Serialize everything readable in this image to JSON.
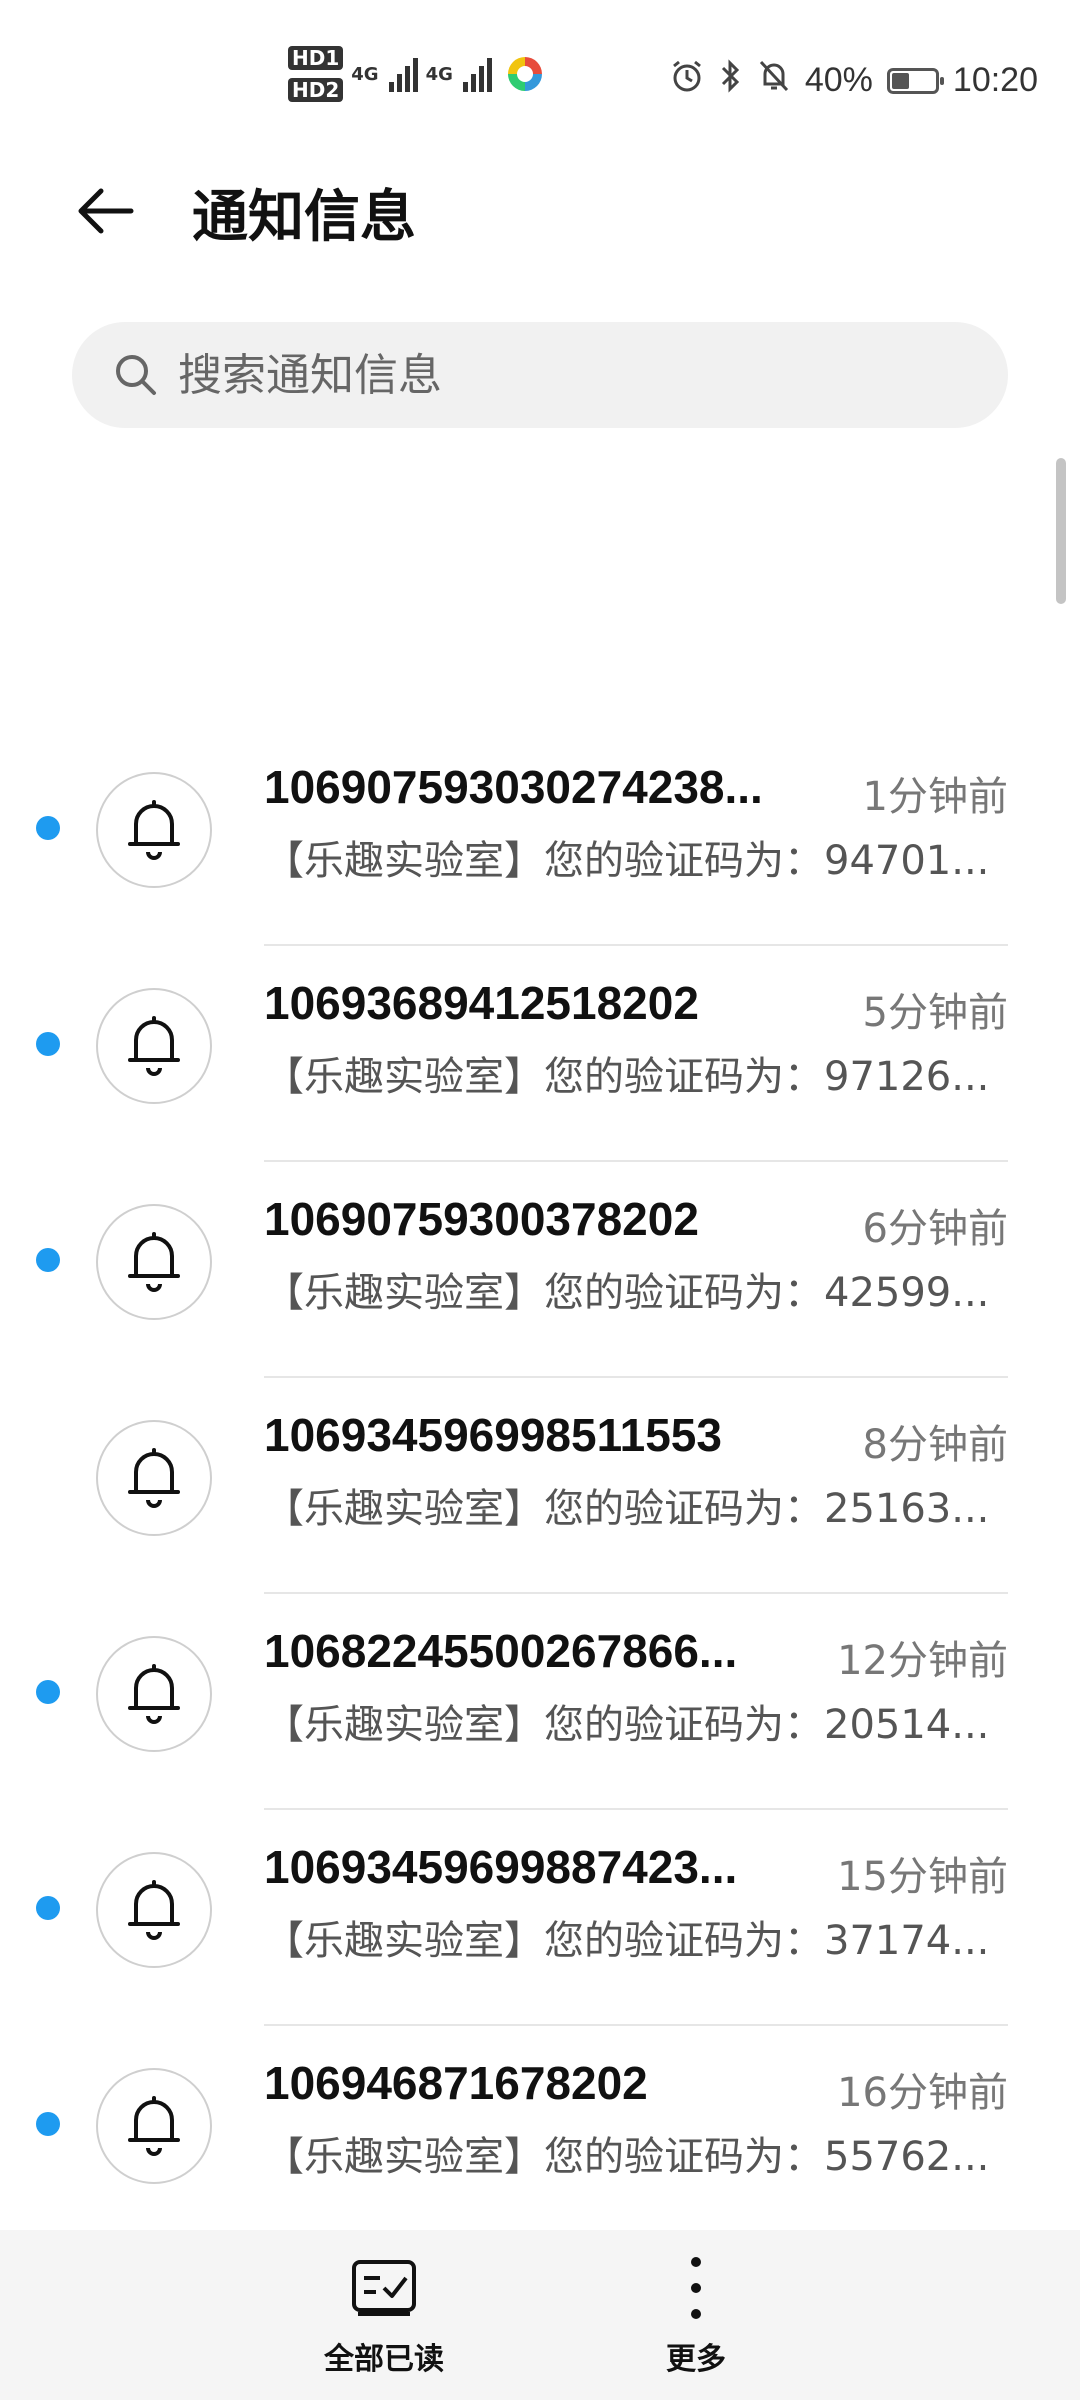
{
  "status_bar": {
    "hd1": "HD1",
    "hd2": "HD2",
    "net1": "4G",
    "net2": "4G",
    "battery_percent": "40%",
    "battery_level": 0.4,
    "time": "10:20",
    "icons": [
      "alarm-icon",
      "bluetooth-icon",
      "mute-bell-icon",
      "battery-icon"
    ]
  },
  "header": {
    "title": "通知信息"
  },
  "search": {
    "placeholder": "搜索通知信息"
  },
  "messages": [
    {
      "sender": "10690759303027423​8...",
      "time": "1分钟前",
      "preview": "【乐趣实验室】您的验证码为：94701...",
      "unread": true
    },
    {
      "sender": "10693689412518202",
      "time": "5分钟前",
      "preview": "【乐趣实验室】您的验证码为：97126...",
      "unread": true
    },
    {
      "sender": "10690759300378202",
      "time": "6分钟前",
      "preview": "【乐趣实验室】您的验证码为：42599...",
      "unread": true
    },
    {
      "sender": "10693459699851155​3",
      "time": "8分钟前",
      "preview": "【乐趣实验室】您的验证码为：25163...",
      "unread": false
    },
    {
      "sender": "10682245500267866...",
      "time": "12分钟前",
      "preview": "【乐趣实验室】您的验证码为：20514...",
      "unread": true
    },
    {
      "sender": "10693459699887423...",
      "time": "15分钟前",
      "preview": "【乐趣实验室】您的验证码为：37174...",
      "unread": true
    },
    {
      "sender": "106946871678202",
      "time": "16分钟前",
      "preview": "【乐趣实验室】您的验证码为：55762...",
      "unread": true
    }
  ],
  "toolbar": {
    "mark_all_read": "全部已读",
    "more": "更多"
  },
  "colors": {
    "unread_dot": "#1e9bf0",
    "toolbar_bg": "#f5f5f5"
  }
}
